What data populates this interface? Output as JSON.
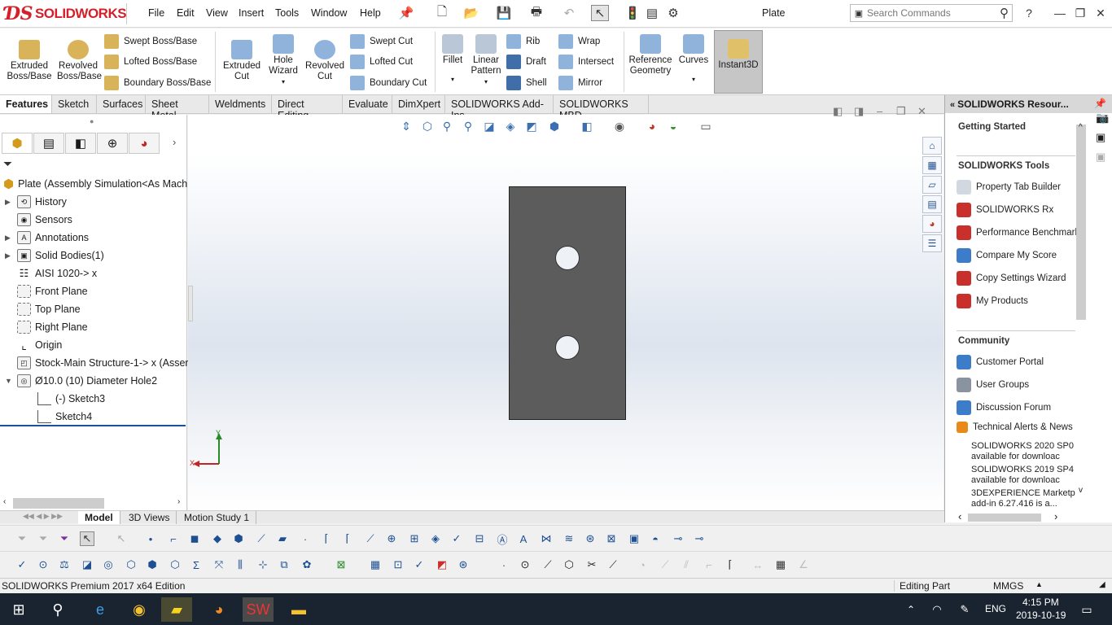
{
  "app": {
    "logo": "SOLIDWORKS",
    "doc_title": "Plate"
  },
  "menu": [
    "File",
    "Edit",
    "View",
    "Insert",
    "Tools",
    "Window",
    "Help"
  ],
  "search": {
    "placeholder": "Search Commands"
  },
  "ribbon": {
    "extruded_boss": "Extruded Boss/Base",
    "revolved_boss": "Revolved Boss/Base",
    "swept_boss": "Swept Boss/Base",
    "lofted_boss": "Lofted Boss/Base",
    "boundary_boss": "Boundary Boss/Base",
    "extruded_cut": "Extruded Cut",
    "hole_wizard": "Hole Wizard",
    "revolved_cut": "Revolved Cut",
    "swept_cut": "Swept Cut",
    "lofted_cut": "Lofted Cut",
    "boundary_cut": "Boundary Cut",
    "fillet": "Fillet",
    "linear_pattern": "Linear Pattern",
    "rib": "Rib",
    "draft": "Draft",
    "shell": "Shell",
    "wrap": "Wrap",
    "intersect": "Intersect",
    "mirror": "Mirror",
    "reference_geometry": "Reference Geometry",
    "curves": "Curves",
    "instant3d": "Instant3D"
  },
  "tabs": [
    "Features",
    "Sketch",
    "Surfaces",
    "Sheet Metal",
    "Weldments",
    "Direct Editing",
    "Evaluate",
    "DimXpert",
    "SOLIDWORKS Add-Ins",
    "SOLIDWORKS MBD"
  ],
  "tree": {
    "root": "Plate  (Assembly Simulation<As Mach",
    "items": [
      "History",
      "Sensors",
      "Annotations",
      "Solid Bodies(1)",
      "AISI 1020-> x",
      "Front Plane",
      "Top Plane",
      "Right Plane",
      "Origin",
      "Stock-Main Structure-1-> x (Asser",
      "Ø10.0 (10) Diameter Hole2",
      "(-) Sketch3",
      "Sketch4"
    ]
  },
  "axes": {
    "y": "Y",
    "x": "X"
  },
  "taskpane": {
    "title": "SOLIDWORKS Resour...",
    "getting_started": "Getting Started",
    "tools_header": "SOLIDWORKS Tools",
    "tools": [
      "Property Tab Builder",
      "SOLIDWORKS Rx",
      "Performance Benchmark",
      "Compare My Score",
      "Copy Settings Wizard",
      "My Products"
    ],
    "community_header": "Community",
    "community": [
      "Customer Portal",
      "User Groups",
      "Discussion Forum"
    ],
    "alerts": "Technical Alerts & News",
    "news": [
      {
        "l1": "SOLIDWORKS 2020 SP0",
        "l2": "available for downloac"
      },
      {
        "l1": "SOLIDWORKS 2019 SP4",
        "l2": "available for downloac"
      },
      {
        "l1": "3DEXPERIENCE Marketp",
        "l2": "add-in 6.27.416 is a..."
      }
    ]
  },
  "bottom_tabs": [
    "Model",
    "3D Views",
    "Motion Study 1"
  ],
  "status": {
    "edition": "SOLIDWORKS Premium 2017 x64 Edition",
    "mode": "Editing Part",
    "units": "MMGS"
  },
  "taskbar": {
    "lang": "ENG",
    "time": "4:15 PM",
    "date": "2019-10-19"
  }
}
